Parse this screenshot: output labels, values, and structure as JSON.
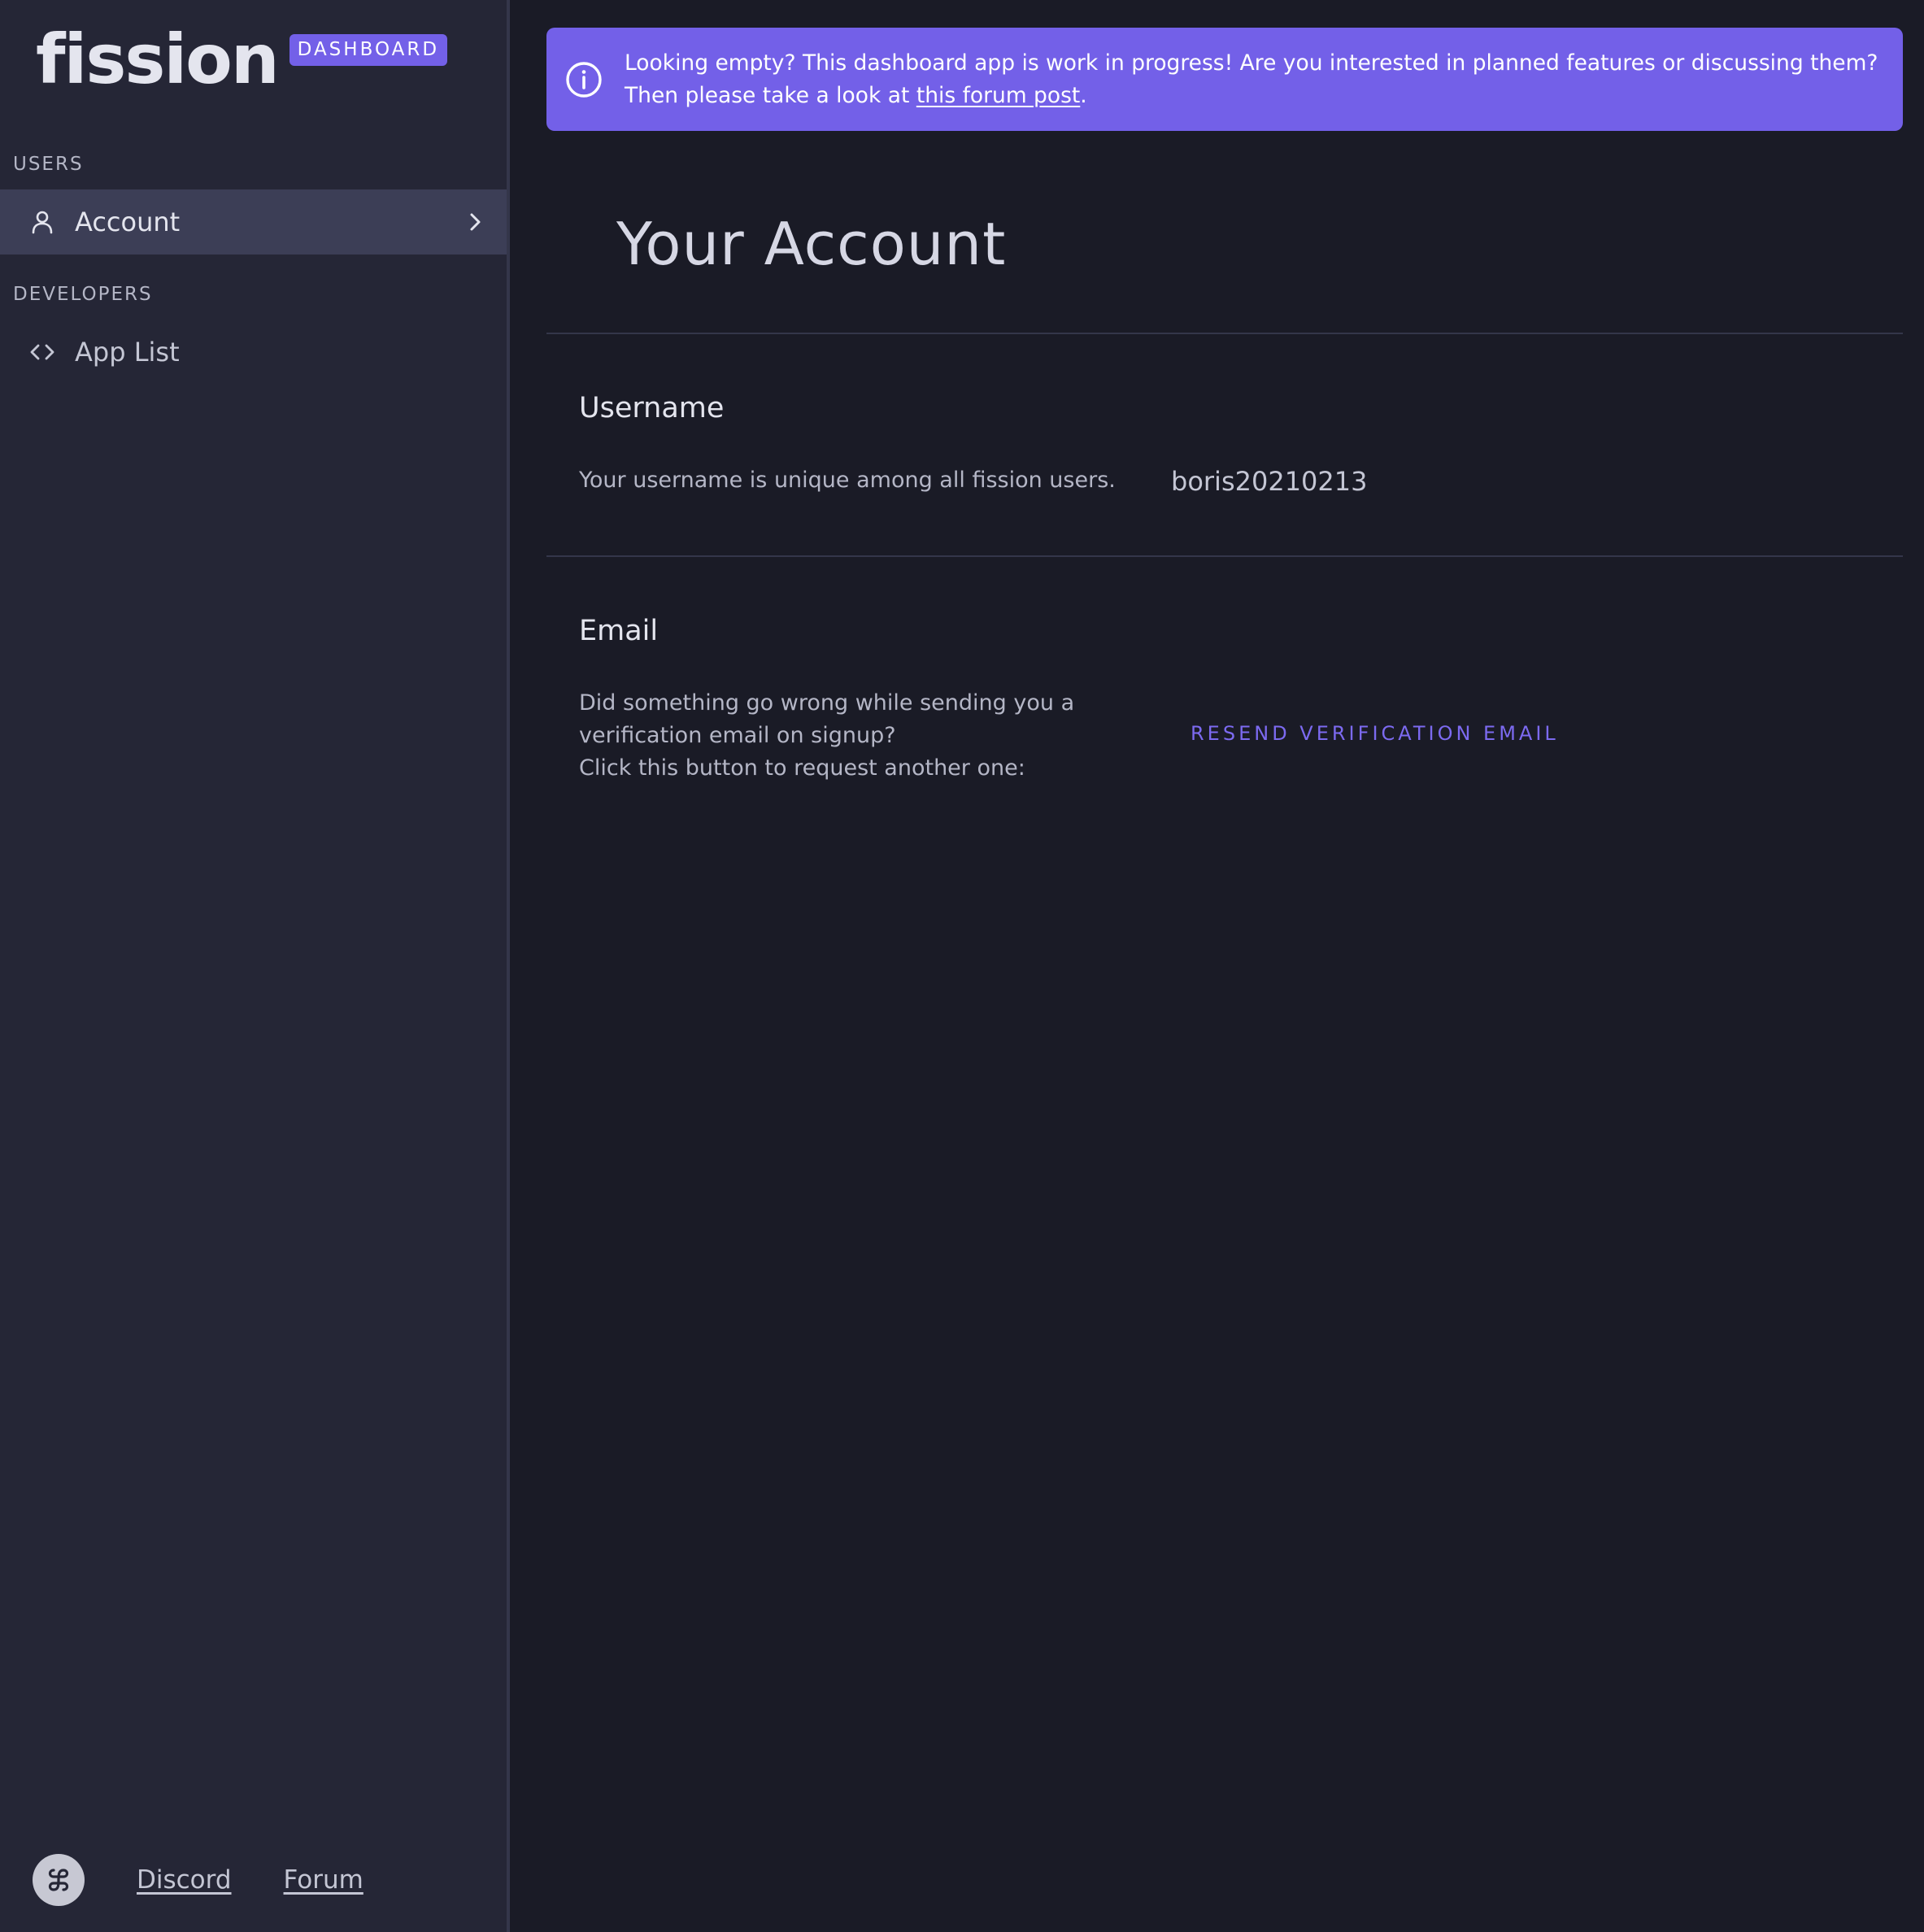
{
  "brand": {
    "name": "fission",
    "badge": "DASHBOARD"
  },
  "sidebar": {
    "sections": [
      {
        "label": "USERS",
        "items": [
          {
            "label": "Account",
            "icon": "user-icon",
            "active": true
          }
        ]
      },
      {
        "label": "DEVELOPERS",
        "items": [
          {
            "label": "App List",
            "icon": "code-icon",
            "active": false
          }
        ]
      }
    ],
    "footer": {
      "links": [
        "Discord",
        "Forum"
      ]
    }
  },
  "banner": {
    "text_before": "Looking empty? This dashboard app is work in progress! Are you interested in planned features or discussing them? Then please take a look at ",
    "link_text": "this forum post",
    "text_after": "."
  },
  "main": {
    "title": "Your Account",
    "username": {
      "heading": "Username",
      "description": "Your username is unique among all fission users.",
      "value": "boris20210213"
    },
    "email": {
      "heading": "Email",
      "description_lines": [
        "Did something go wrong while sending you a",
        "verification email on signup?",
        "Click this button to request another one:"
      ],
      "button_label": "RESEND VERIFICATION EMAIL"
    }
  },
  "colors": {
    "accent": "#7360e8",
    "background": "#1a1b26",
    "sidebar": "#252636",
    "active_item": "#3c3e56"
  }
}
